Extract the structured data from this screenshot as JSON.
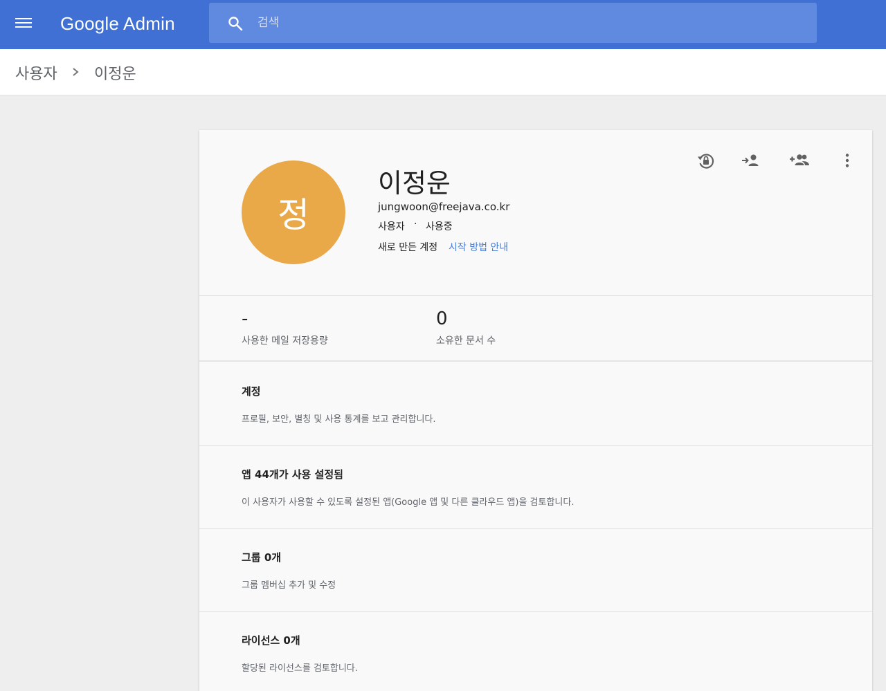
{
  "header": {
    "logo_text": "Google Admin",
    "search_placeholder": "검색"
  },
  "breadcrumb": {
    "root": "사용자",
    "current": "이정운"
  },
  "user": {
    "avatar_initial": "정",
    "avatar_color": "#e9a948",
    "name": "이정운",
    "email": "jungwoon@freejava.co.kr",
    "role": "사용자",
    "separator": "·",
    "status": "사용중",
    "new_account": "새로 만든 계정",
    "start_link": "시작 방법 안내"
  },
  "actions": {
    "icons": [
      "lock-reset-icon",
      "rename-user-icon",
      "add-to-group-icon",
      "more-vert-icon"
    ]
  },
  "stats": [
    {
      "value": "-",
      "label": "사용한 메일 저장용량"
    },
    {
      "value": "0",
      "label": "소유한 문서 수"
    }
  ],
  "sections": [
    {
      "title": "계정",
      "desc": "프로필, 보안, 별칭 및 사용 통계를 보고 관리합니다."
    },
    {
      "title": "앱 44개가 사용 설정됨",
      "desc": "이 사용자가 사용할 수 있도록 설정된 앱(Google 앱 및 다른 클라우드 앱)을 검토합니다."
    },
    {
      "title": "그룹 0개",
      "desc": "그룹 멤버십 추가 및 수정"
    },
    {
      "title": "라이선스 0개",
      "desc": "할당된 라이선스를 검토합니다."
    }
  ],
  "colors": {
    "topbar": "#4170d4",
    "search_bg": "#6089e0",
    "link": "#4a7fd8"
  }
}
